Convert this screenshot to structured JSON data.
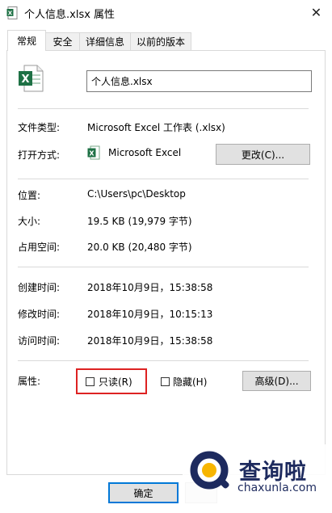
{
  "window": {
    "title": "个人信息.xlsx 属性",
    "close_glyph": "✕"
  },
  "tabs": [
    {
      "label": "常规",
      "active": true
    },
    {
      "label": "安全",
      "active": false
    },
    {
      "label": "详细信息",
      "active": false
    },
    {
      "label": "以前的版本",
      "active": false
    }
  ],
  "file": {
    "name": "个人信息.xlsx",
    "icon": "excel-file-icon"
  },
  "type_row": {
    "label": "文件类型:",
    "value": "Microsoft Excel 工作表 (.xlsx)"
  },
  "open_with_row": {
    "label": "打开方式:",
    "app": "Microsoft Excel",
    "change_button": "更改(C)..."
  },
  "location_row": {
    "label": "位置:",
    "value": "C:\\Users\\pc\\Desktop"
  },
  "size_row": {
    "label": "大小:",
    "value": "19.5 KB (19,979 字节)"
  },
  "disk_size_row": {
    "label": "占用空间:",
    "value": "20.0 KB (20,480 字节)"
  },
  "created_row": {
    "label": "创建时间:",
    "value": "2018年10月9日，15:38:58"
  },
  "modified_row": {
    "label": "修改时间:",
    "value": "2018年10月9日，10:15:13"
  },
  "accessed_row": {
    "label": "访问时间:",
    "value": "2018年10月9日，15:38:58"
  },
  "attributes": {
    "label": "属性:",
    "readonly": {
      "label": "只读(R)",
      "checked": false
    },
    "hidden": {
      "label": "隐藏(H)",
      "checked": false
    },
    "advanced_button": "高级(D)..."
  },
  "footer": {
    "ok_button": "确定"
  },
  "watermark": {
    "text": "查询啦",
    "sub": "chaxunla.com"
  },
  "colors": {
    "highlight_border": "#dd2222",
    "accent": "#0078d7",
    "excel_green": "#1e7145"
  }
}
